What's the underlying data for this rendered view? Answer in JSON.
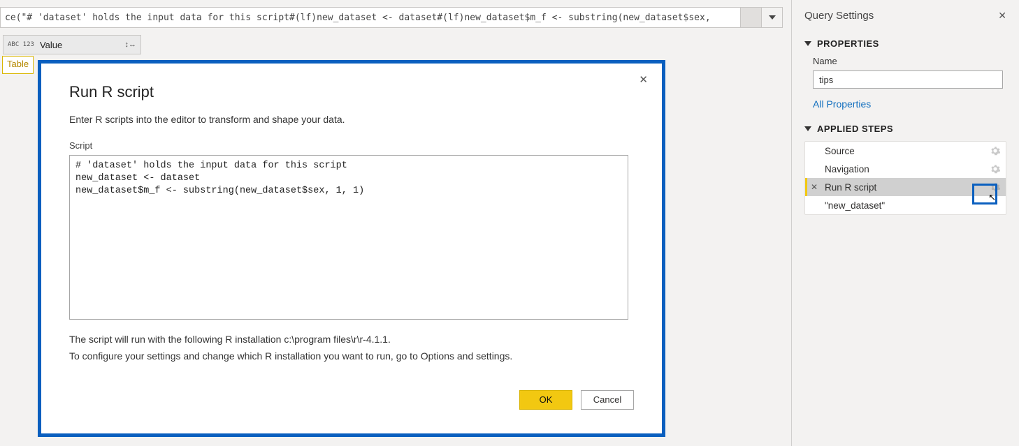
{
  "formula_bar": {
    "text": "ce(\"# 'dataset' holds the input data for this script#(lf)new_dataset <- dataset#(lf)new_dataset$m_f <- substring(new_dataset$sex,"
  },
  "grid": {
    "col_type_badge": "ABC\n123",
    "col_name": "Value",
    "row1": "Table"
  },
  "dialog": {
    "title": "Run R script",
    "subtitle": "Enter R scripts into the editor to transform and shape your data.",
    "script_label": "Script",
    "script_text": "# 'dataset' holds the input data for this script\nnew_dataset <- dataset\nnew_dataset$m_f <- substring(new_dataset$sex, 1, 1)",
    "note_line1": "The script will run with the following R installation c:\\program files\\r\\r-4.1.1.",
    "note_line2": "To configure your settings and change which R installation you want to run, go to Options and settings.",
    "ok_label": "OK",
    "cancel_label": "Cancel"
  },
  "panel": {
    "title": "Query Settings",
    "section_properties": "PROPERTIES",
    "name_label": "Name",
    "name_value": "tips",
    "all_properties": "All Properties",
    "section_steps": "APPLIED STEPS",
    "steps": [
      {
        "label": "Source",
        "gear": true
      },
      {
        "label": "Navigation",
        "gear": true
      },
      {
        "label": "Run R script",
        "gear": true,
        "selected": true,
        "deletable": true
      },
      {
        "label": "\"new_dataset\"",
        "gear": false
      }
    ]
  }
}
